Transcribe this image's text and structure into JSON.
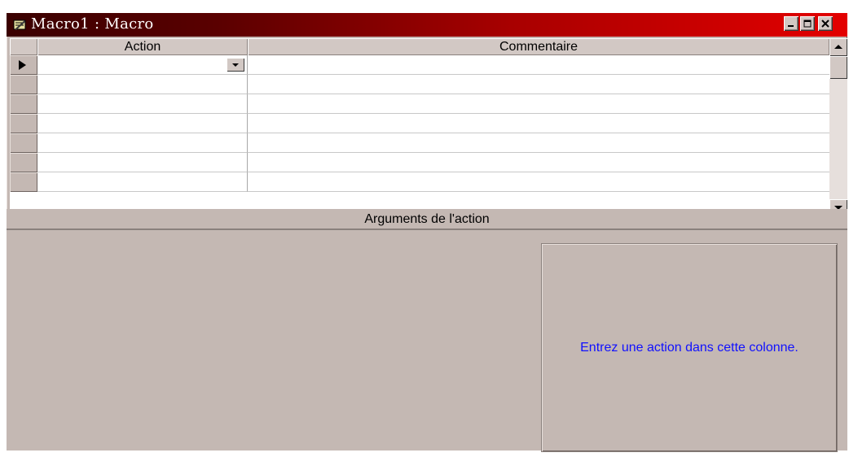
{
  "window": {
    "title": "Macro1 : Macro",
    "icon": "macro-icon",
    "controls": [
      "minimize-icon",
      "maximize-icon",
      "close-icon"
    ]
  },
  "grid": {
    "columns": [
      "Action",
      "Commentaire"
    ],
    "rows": [
      {
        "action": "",
        "comment": "",
        "current": true
      },
      {
        "action": "",
        "comment": ""
      },
      {
        "action": "",
        "comment": ""
      },
      {
        "action": "",
        "comment": ""
      },
      {
        "action": "",
        "comment": ""
      },
      {
        "action": "",
        "comment": ""
      },
      {
        "action": "",
        "comment": ""
      }
    ]
  },
  "arguments": {
    "title": "Arguments de l'action",
    "help_text": "Entrez une action dans cette colonne."
  },
  "colors": {
    "title_gradient_start": "#3a0000",
    "title_gradient_end": "#e30000",
    "window_face": "#c4b8b3",
    "help_text": "#1010ff"
  }
}
